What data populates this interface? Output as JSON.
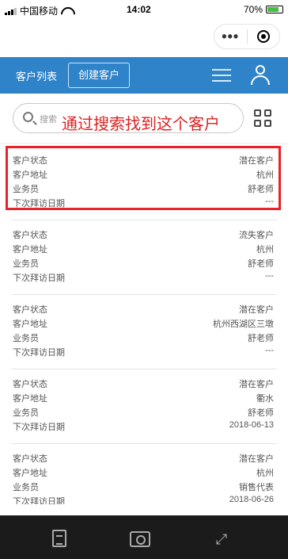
{
  "status_bar": {
    "carrier": "中国移动",
    "time": "14:02",
    "battery": "70%"
  },
  "header": {
    "tab_list": "客户列表",
    "tab_create": "创建客户"
  },
  "search": {
    "placeholder": "搜索"
  },
  "annotation": "通过搜索找到这个客户",
  "labels": {
    "status": "客户状态",
    "address": "客户地址",
    "salesperson": "业务员",
    "next_visit": "下次拜访日期"
  },
  "customers": [
    {
      "status": "潜在客户",
      "address": "杭州",
      "salesperson": "舒老师",
      "next_visit": "---"
    },
    {
      "status": "流失客户",
      "address": "杭州",
      "salesperson": "舒老师",
      "next_visit": "---"
    },
    {
      "status": "潜在客户",
      "address": "杭州西湖区三墩",
      "salesperson": "舒老师",
      "next_visit": "---"
    },
    {
      "status": "潜在客户",
      "address": "衢水",
      "salesperson": "舒老师",
      "next_visit": "2018-06-13"
    },
    {
      "status": "潜在客户",
      "address": "杭州",
      "salesperson": "销售代表",
      "next_visit": "2018-06-26"
    }
  ],
  "icons": {
    "capsule_more": "more-dots-icon",
    "capsule_close": "close-ring-icon",
    "menu": "list-menu-icon",
    "user": "user-icon",
    "search": "search-icon",
    "grid": "grid-view-icon",
    "toolbar": [
      "document-icon",
      "camera-icon",
      "expand-icon"
    ]
  },
  "colors": {
    "header_blue": "#2f84c9",
    "highlight_red": "#e8232b",
    "toolbar_bg": "#1b1b1b"
  }
}
